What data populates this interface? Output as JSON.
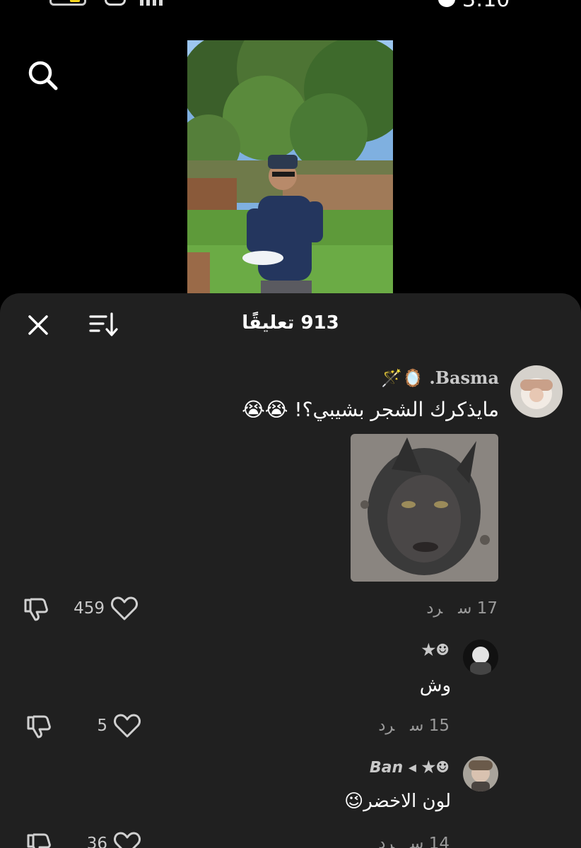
{
  "status_bar": {
    "time": "3:10"
  },
  "header": {
    "search_icon": "search-icon"
  },
  "comments_sheet": {
    "title": "913 تعليقًا",
    "close_icon": "close-icon",
    "sort_icon": "sort-icon"
  },
  "comments": [
    {
      "username": "Basma. 🪞🪄",
      "text": "مايذكرك الشجر بشيبي؟! 😭😭",
      "time": "17 س",
      "reply_label": "رد",
      "likes": "459",
      "has_sticker": true
    },
    {
      "username": "☻★",
      "text": "وش",
      "time": "15 س",
      "reply_label": "رد",
      "likes": "5"
    },
    {
      "username": "☻★ ◂ 𝘽𝙖𝙣",
      "text": "لون الاخضر😉",
      "time": "14 س",
      "reply_label": "رد",
      "likes": "36"
    }
  ],
  "colors": {
    "background": "#000000",
    "sheet": "#202020",
    "secondary_text": "#9a9a9a",
    "username_text": "#c8c8c8"
  }
}
